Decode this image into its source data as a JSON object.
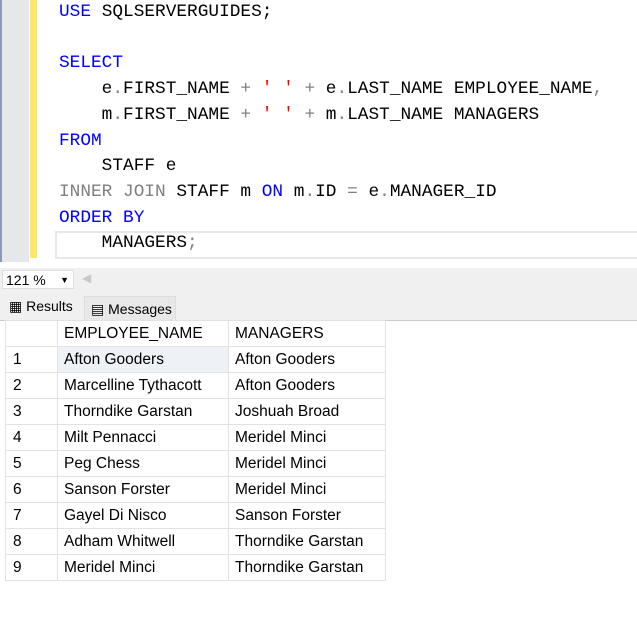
{
  "code": {
    "use_kw": "USE",
    "db": "SQLSERVERGUIDES;",
    "select_kw": "SELECT",
    "line1": {
      "a": "    e",
      "b": ".",
      "c": "FIRST_NAME ",
      "d": "+ ",
      "s": "' '",
      "e": " + ",
      "f": "e",
      ".": ".",
      "g": "LAST_NAME EMPLOYEE_NAME",
      "h": ","
    },
    "line2": {
      "a": "    m",
      "c": "FIRST_NAME ",
      "g": "LAST_NAME MANAGERS"
    },
    "from_kw": "FROM",
    "from_tbl": "    STAFF e",
    "join_kw": "INNER JOIN",
    "join_tbl": " STAFF m ",
    "on_kw": "ON",
    "join_cond_a": " m",
    "join_cond_b": "ID ",
    "eq": "=",
    "join_cond_c": " e",
    "join_cond_d": "MANAGER_ID",
    "order_kw": "ORDER BY",
    "order_col": "    MANAGERS",
    "semi": ";"
  },
  "zoom": {
    "value": "121 %"
  },
  "tabs": {
    "results": "Results",
    "messages": "Messages"
  },
  "grid": {
    "headers": [
      "EMPLOYEE_NAME",
      "MANAGERS"
    ],
    "rows": [
      [
        "1",
        "Afton Gooders",
        "Afton Gooders"
      ],
      [
        "2",
        "Marcelline Tythacott",
        "Afton Gooders"
      ],
      [
        "3",
        "Thorndike Garstan",
        "Joshuah Broad"
      ],
      [
        "4",
        "Milt Pennacci",
        "Meridel Minci"
      ],
      [
        "5",
        "Peg Chess",
        "Meridel Minci"
      ],
      [
        "6",
        "Sanson Forster",
        "Meridel Minci"
      ],
      [
        "7",
        "Gayel Di Nisco",
        "Sanson Forster"
      ],
      [
        "8",
        "Adham Whitwell",
        "Thorndike Garstan"
      ],
      [
        "9",
        "Meridel Minci",
        "Thorndike Garstan"
      ]
    ]
  }
}
